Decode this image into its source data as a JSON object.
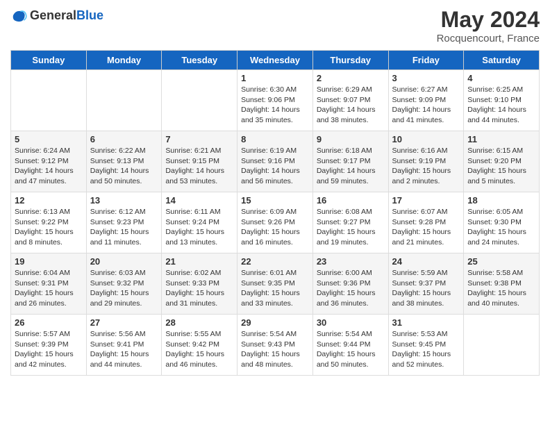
{
  "logo": {
    "text_general": "General",
    "text_blue": "Blue"
  },
  "title": "May 2024",
  "subtitle": "Rocquencourt, France",
  "days_of_week": [
    "Sunday",
    "Monday",
    "Tuesday",
    "Wednesday",
    "Thursday",
    "Friday",
    "Saturday"
  ],
  "weeks": [
    [
      {
        "date": "",
        "info": ""
      },
      {
        "date": "",
        "info": ""
      },
      {
        "date": "",
        "info": ""
      },
      {
        "date": "1",
        "sunrise": "Sunrise: 6:30 AM",
        "sunset": "Sunset: 9:06 PM",
        "daylight": "Daylight: 14 hours and 35 minutes."
      },
      {
        "date": "2",
        "sunrise": "Sunrise: 6:29 AM",
        "sunset": "Sunset: 9:07 PM",
        "daylight": "Daylight: 14 hours and 38 minutes."
      },
      {
        "date": "3",
        "sunrise": "Sunrise: 6:27 AM",
        "sunset": "Sunset: 9:09 PM",
        "daylight": "Daylight: 14 hours and 41 minutes."
      },
      {
        "date": "4",
        "sunrise": "Sunrise: 6:25 AM",
        "sunset": "Sunset: 9:10 PM",
        "daylight": "Daylight: 14 hours and 44 minutes."
      }
    ],
    [
      {
        "date": "5",
        "sunrise": "Sunrise: 6:24 AM",
        "sunset": "Sunset: 9:12 PM",
        "daylight": "Daylight: 14 hours and 47 minutes."
      },
      {
        "date": "6",
        "sunrise": "Sunrise: 6:22 AM",
        "sunset": "Sunset: 9:13 PM",
        "daylight": "Daylight: 14 hours and 50 minutes."
      },
      {
        "date": "7",
        "sunrise": "Sunrise: 6:21 AM",
        "sunset": "Sunset: 9:15 PM",
        "daylight": "Daylight: 14 hours and 53 minutes."
      },
      {
        "date": "8",
        "sunrise": "Sunrise: 6:19 AM",
        "sunset": "Sunset: 9:16 PM",
        "daylight": "Daylight: 14 hours and 56 minutes."
      },
      {
        "date": "9",
        "sunrise": "Sunrise: 6:18 AM",
        "sunset": "Sunset: 9:17 PM",
        "daylight": "Daylight: 14 hours and 59 minutes."
      },
      {
        "date": "10",
        "sunrise": "Sunrise: 6:16 AM",
        "sunset": "Sunset: 9:19 PM",
        "daylight": "Daylight: 15 hours and 2 minutes."
      },
      {
        "date": "11",
        "sunrise": "Sunrise: 6:15 AM",
        "sunset": "Sunset: 9:20 PM",
        "daylight": "Daylight: 15 hours and 5 minutes."
      }
    ],
    [
      {
        "date": "12",
        "sunrise": "Sunrise: 6:13 AM",
        "sunset": "Sunset: 9:22 PM",
        "daylight": "Daylight: 15 hours and 8 minutes."
      },
      {
        "date": "13",
        "sunrise": "Sunrise: 6:12 AM",
        "sunset": "Sunset: 9:23 PM",
        "daylight": "Daylight: 15 hours and 11 minutes."
      },
      {
        "date": "14",
        "sunrise": "Sunrise: 6:11 AM",
        "sunset": "Sunset: 9:24 PM",
        "daylight": "Daylight: 15 hours and 13 minutes."
      },
      {
        "date": "15",
        "sunrise": "Sunrise: 6:09 AM",
        "sunset": "Sunset: 9:26 PM",
        "daylight": "Daylight: 15 hours and 16 minutes."
      },
      {
        "date": "16",
        "sunrise": "Sunrise: 6:08 AM",
        "sunset": "Sunset: 9:27 PM",
        "daylight": "Daylight: 15 hours and 19 minutes."
      },
      {
        "date": "17",
        "sunrise": "Sunrise: 6:07 AM",
        "sunset": "Sunset: 9:28 PM",
        "daylight": "Daylight: 15 hours and 21 minutes."
      },
      {
        "date": "18",
        "sunrise": "Sunrise: 6:05 AM",
        "sunset": "Sunset: 9:30 PM",
        "daylight": "Daylight: 15 hours and 24 minutes."
      }
    ],
    [
      {
        "date": "19",
        "sunrise": "Sunrise: 6:04 AM",
        "sunset": "Sunset: 9:31 PM",
        "daylight": "Daylight: 15 hours and 26 minutes."
      },
      {
        "date": "20",
        "sunrise": "Sunrise: 6:03 AM",
        "sunset": "Sunset: 9:32 PM",
        "daylight": "Daylight: 15 hours and 29 minutes."
      },
      {
        "date": "21",
        "sunrise": "Sunrise: 6:02 AM",
        "sunset": "Sunset: 9:33 PM",
        "daylight": "Daylight: 15 hours and 31 minutes."
      },
      {
        "date": "22",
        "sunrise": "Sunrise: 6:01 AM",
        "sunset": "Sunset: 9:35 PM",
        "daylight": "Daylight: 15 hours and 33 minutes."
      },
      {
        "date": "23",
        "sunrise": "Sunrise: 6:00 AM",
        "sunset": "Sunset: 9:36 PM",
        "daylight": "Daylight: 15 hours and 36 minutes."
      },
      {
        "date": "24",
        "sunrise": "Sunrise: 5:59 AM",
        "sunset": "Sunset: 9:37 PM",
        "daylight": "Daylight: 15 hours and 38 minutes."
      },
      {
        "date": "25",
        "sunrise": "Sunrise: 5:58 AM",
        "sunset": "Sunset: 9:38 PM",
        "daylight": "Daylight: 15 hours and 40 minutes."
      }
    ],
    [
      {
        "date": "26",
        "sunrise": "Sunrise: 5:57 AM",
        "sunset": "Sunset: 9:39 PM",
        "daylight": "Daylight: 15 hours and 42 minutes."
      },
      {
        "date": "27",
        "sunrise": "Sunrise: 5:56 AM",
        "sunset": "Sunset: 9:41 PM",
        "daylight": "Daylight: 15 hours and 44 minutes."
      },
      {
        "date": "28",
        "sunrise": "Sunrise: 5:55 AM",
        "sunset": "Sunset: 9:42 PM",
        "daylight": "Daylight: 15 hours and 46 minutes."
      },
      {
        "date": "29",
        "sunrise": "Sunrise: 5:54 AM",
        "sunset": "Sunset: 9:43 PM",
        "daylight": "Daylight: 15 hours and 48 minutes."
      },
      {
        "date": "30",
        "sunrise": "Sunrise: 5:54 AM",
        "sunset": "Sunset: 9:44 PM",
        "daylight": "Daylight: 15 hours and 50 minutes."
      },
      {
        "date": "31",
        "sunrise": "Sunrise: 5:53 AM",
        "sunset": "Sunset: 9:45 PM",
        "daylight": "Daylight: 15 hours and 52 minutes."
      },
      {
        "date": "",
        "info": ""
      }
    ]
  ]
}
